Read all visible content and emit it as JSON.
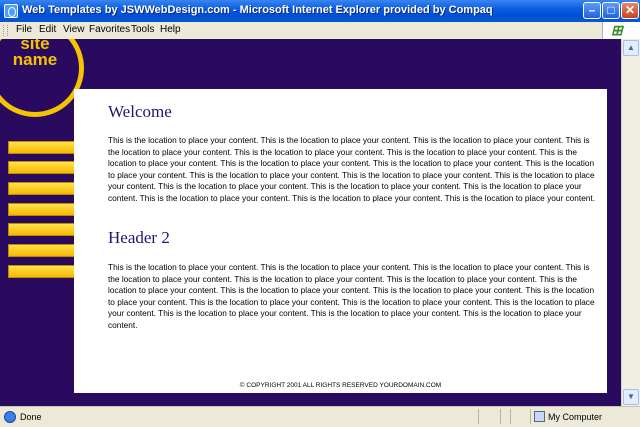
{
  "window": {
    "title": "Web Templates by JSWWebDesign.com - Microsoft Internet Explorer provided by Compaq",
    "min_label": "–",
    "max_label": "□",
    "close_label": "✕"
  },
  "menu": {
    "items": [
      "File",
      "Edit",
      "View",
      "Favorites",
      "Tools",
      "Help"
    ]
  },
  "logo": {
    "line1": "site",
    "line2": "name"
  },
  "page": {
    "heading1": "Welcome",
    "paragraph1": "This is the location to place your content. This is the location to place your content. This is the location to place your content. This is the location to place your content. This is the location to place your content. This is the location to place your content. This is the location to place your content. This is the location to place your content. This is the location to place your content. This is the location to place your content. This is the location to place your content. This is the location to place your content. This is the location to place your content. This is the location to place your content. This is the location to place your content. This is the location to place your content. This is the location to place your content. This is the location to place your content. This is the location to place your content.",
    "heading2": "Header 2",
    "paragraph2": "This is the location to place your content. This is the location to place your content. This is the location to place your content. This is the location to place your content. This is the location to place your content. This is the location to place your content. This is the location to place your content. This is the location to place your content. This is the location to place your content. This is the location to place your content. This is the location to place your content. This is the location to place your content. This is the location to place your content. This is the location to place your content. This is the location to place your content. This is the location to place your content.",
    "footer": "© COPYRIGHT 2001 ALL RIGHTS RESERVED YOURDOMAIN.COM"
  },
  "status": {
    "left": "Done",
    "zone": "My Computer"
  },
  "colors": {
    "page_bg": "#2a0a5e",
    "accent": "#f5c400",
    "heading": "#1a1a6e"
  }
}
